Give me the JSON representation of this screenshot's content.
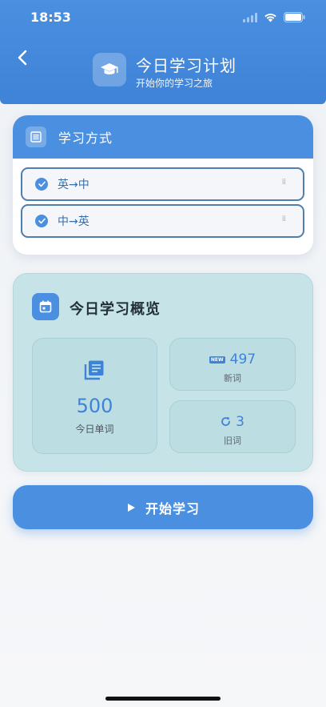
{
  "status_bar": {
    "time": "18:53"
  },
  "header": {
    "title": "今日学习计划",
    "subtitle": "开始你的学习之旅",
    "icon": "graduation-cap-icon"
  },
  "study_method": {
    "title": "学习方式",
    "options": [
      {
        "label": "英→中",
        "checked": true
      },
      {
        "label": "中→英",
        "checked": true
      }
    ]
  },
  "overview": {
    "title": "今日学习概览",
    "total": {
      "value": "500",
      "label": "今日单词"
    },
    "new_words": {
      "value": "497",
      "label": "新词",
      "badge": "NEW"
    },
    "old_words": {
      "value": "3",
      "label": "旧词"
    }
  },
  "start_button": {
    "label": "开始学习"
  },
  "colors": {
    "accent": "#4a8fe0",
    "overview_bg": "#c6e4e7",
    "option_border": "#4e7fae"
  }
}
